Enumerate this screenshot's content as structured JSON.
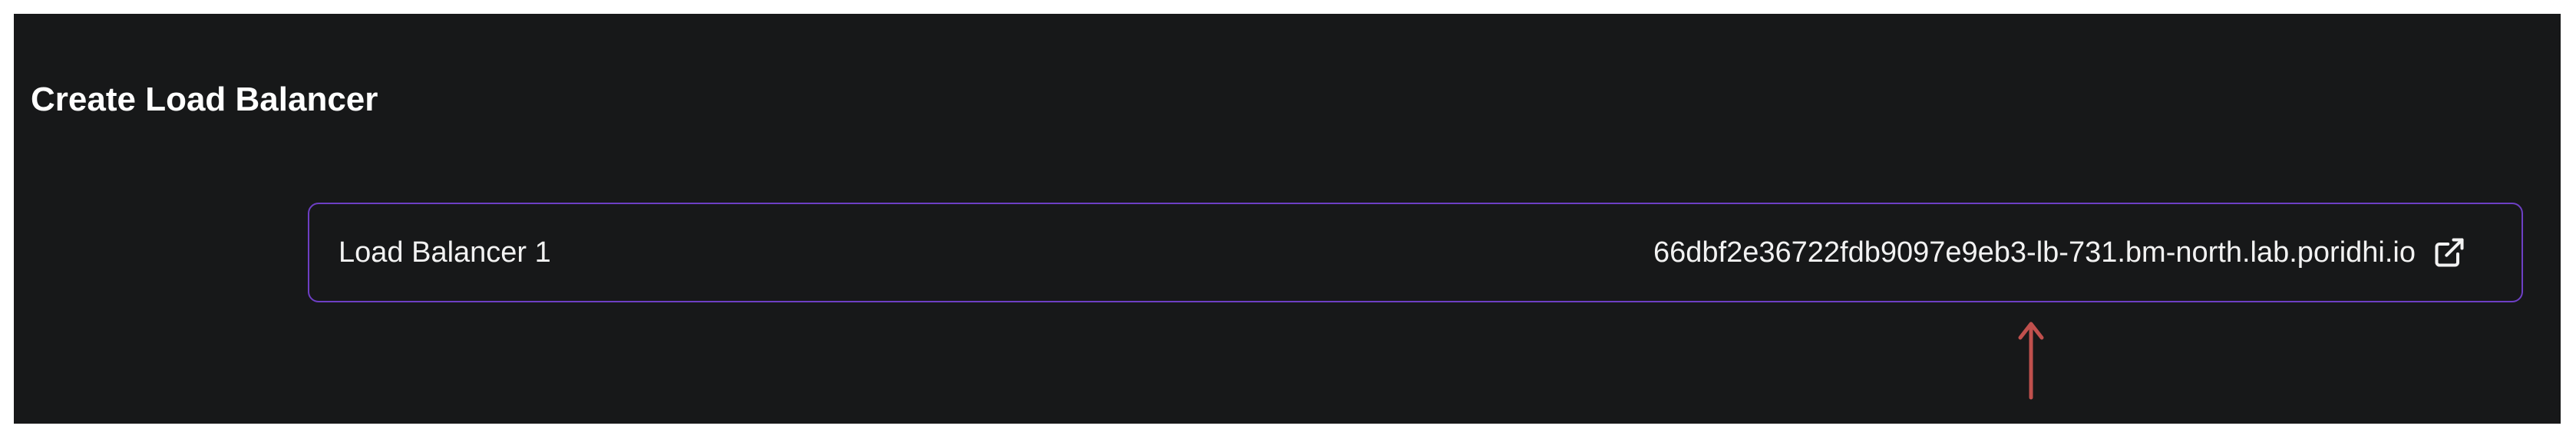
{
  "panel": {
    "title": "Create Load Balancer"
  },
  "load_balancers": [
    {
      "name": "Load Balancer 1",
      "url": "66dbf2e36722fdb9097e9eb3-lb-731.bm-north.lab.poridhi.io",
      "link_icon": "external-link-icon"
    }
  ],
  "colors": {
    "panel_background": "#171819",
    "card_border": "#6d3fc4",
    "text": "#f2f2f2",
    "annotation_arrow": "#c0504d"
  }
}
